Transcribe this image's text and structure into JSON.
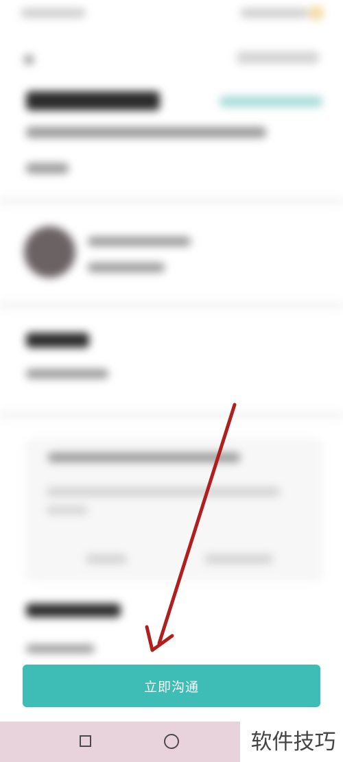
{
  "primary_action": {
    "label": "立即沟通"
  },
  "watermark": {
    "text": "软件技巧"
  },
  "nav": {
    "back": "square-icon",
    "home": "circle-icon"
  },
  "colors": {
    "accent": "#3dbdb5",
    "arrow": "#b01e1e",
    "nav_bg": "#e8d3dc"
  }
}
